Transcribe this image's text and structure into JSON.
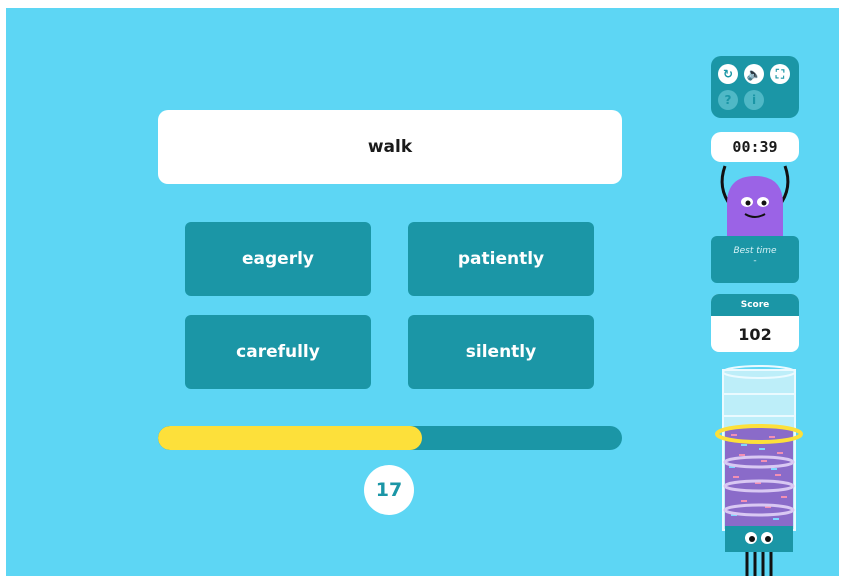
{
  "prompt": {
    "word": "walk"
  },
  "answers": [
    "eagerly",
    "patiently",
    "carefully",
    "silently"
  ],
  "progress": {
    "fraction": 0.57,
    "counter": "17"
  },
  "controls": {
    "buttons": [
      {
        "icon": "restart-icon",
        "glyph": "↻"
      },
      {
        "icon": "sound-icon",
        "glyph": "🔈"
      },
      {
        "icon": "fullscreen-icon",
        "glyph": "⛶"
      },
      {
        "icon": "help-icon",
        "glyph": "?"
      },
      {
        "icon": "info-icon",
        "glyph": "i"
      }
    ]
  },
  "timer": {
    "value": "00:39"
  },
  "best_time": {
    "label": "Best time",
    "value": "-"
  },
  "score": {
    "label": "Score",
    "value": "102"
  },
  "colors": {
    "background": "#5dd6f4",
    "tile": "#1b96a6",
    "progress": "#fde03a",
    "monster": "#9b63e6"
  }
}
